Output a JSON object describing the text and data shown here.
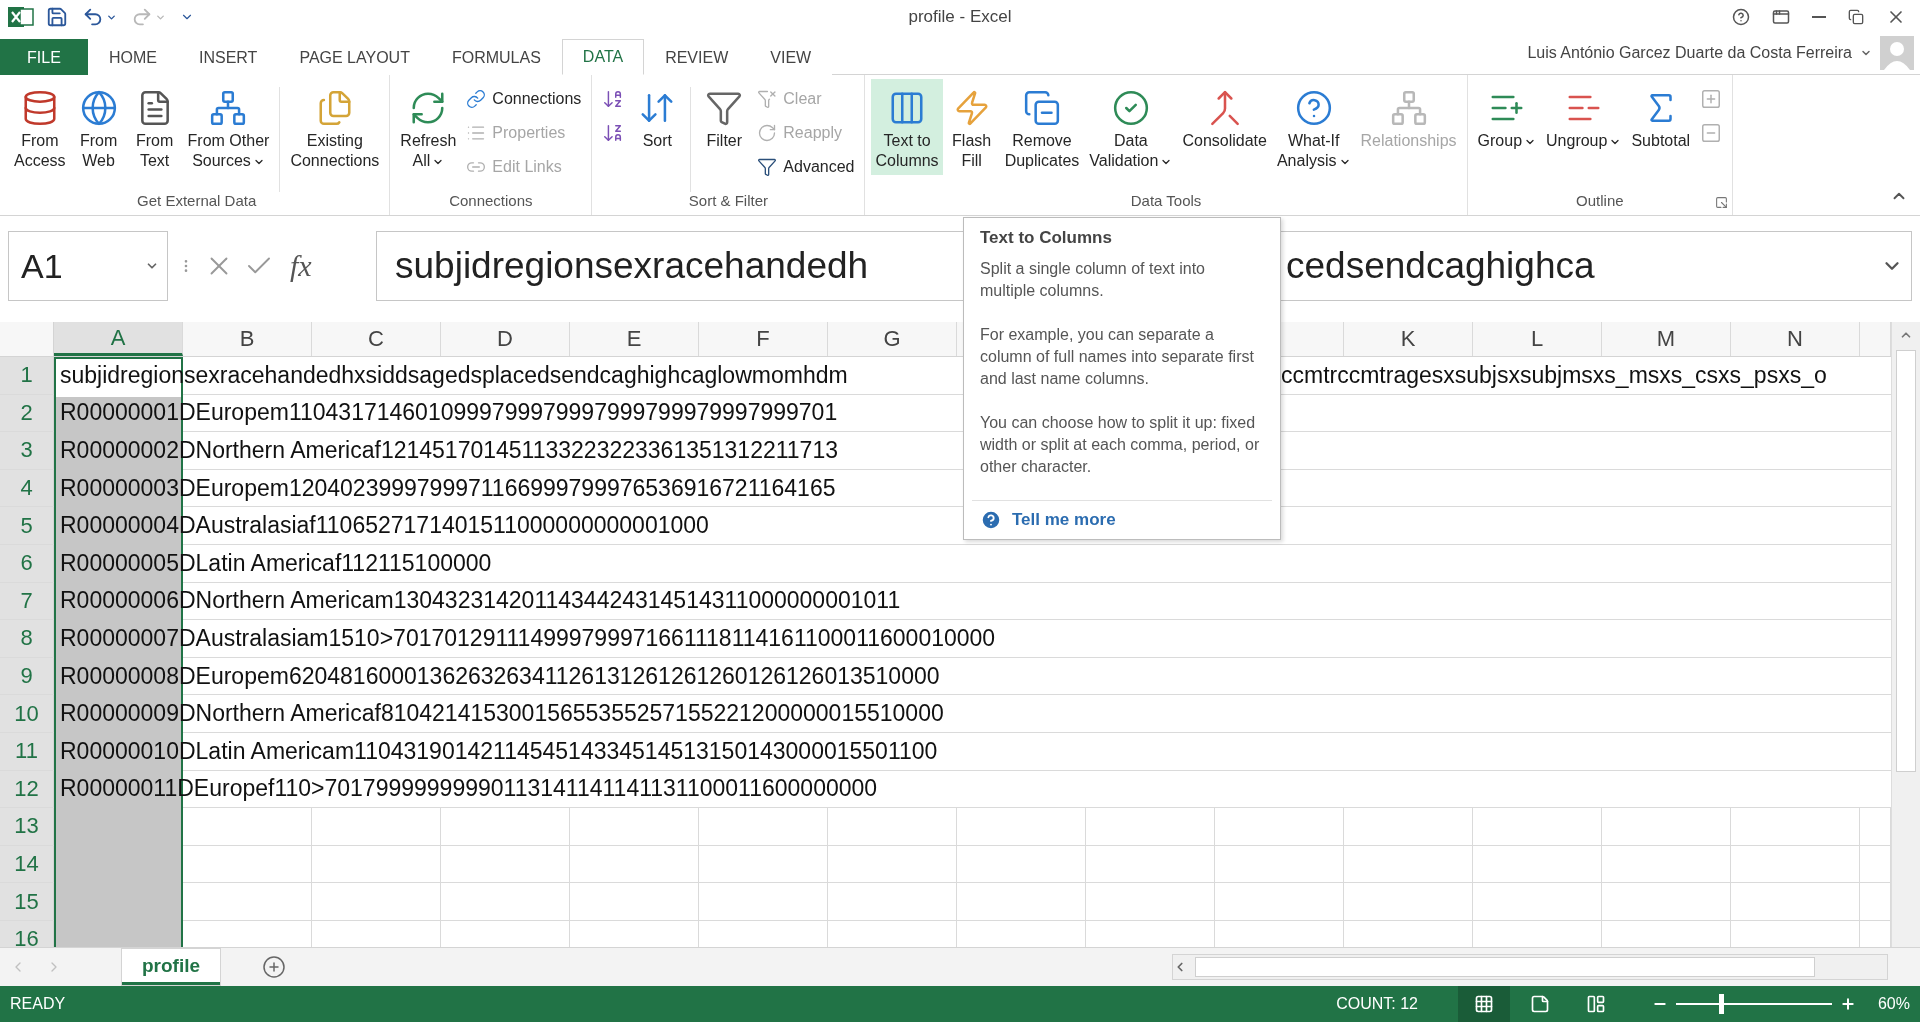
{
  "title_bar": {
    "title": "profile - Excel",
    "quick_access": [
      {
        "kind": "save",
        "disabled": false
      },
      {
        "kind": "undo",
        "disabled": false
      },
      {
        "kind": "redo",
        "disabled": true
      },
      {
        "kind": "customize",
        "disabled": false
      }
    ]
  },
  "ribbon_tabs": [
    {
      "label": "FILE",
      "kind": "file",
      "selected": false
    },
    {
      "label": "HOME",
      "kind": "tab",
      "selected": false
    },
    {
      "label": "INSERT",
      "kind": "tab",
      "selected": false
    },
    {
      "label": "PAGE LAYOUT",
      "kind": "tab",
      "selected": false
    },
    {
      "label": "FORMULAS",
      "kind": "tab",
      "selected": false
    },
    {
      "label": "DATA",
      "kind": "tab",
      "selected": true
    },
    {
      "label": "REVIEW",
      "kind": "tab",
      "selected": false
    },
    {
      "label": "VIEW",
      "kind": "tab",
      "selected": false
    }
  ],
  "account": {
    "user": "Luis António Garcez Duarte da Costa Ferreira"
  },
  "ribbon_groups": [
    {
      "label": "Get External Data",
      "launcher": false,
      "items": [
        {
          "kind": "large",
          "lines": [
            "From",
            "Access"
          ],
          "dropdown": false,
          "disabled": false,
          "highlighted": false
        },
        {
          "kind": "large",
          "lines": [
            "From",
            "Web"
          ],
          "dropdown": false,
          "disabled": false,
          "highlighted": false
        },
        {
          "kind": "large",
          "lines": [
            "From",
            "Text"
          ],
          "dropdown": false,
          "disabled": false,
          "highlighted": false
        },
        {
          "kind": "large",
          "lines": [
            "From Other",
            "Sources"
          ],
          "dropdown": true,
          "disabled": false,
          "highlighted": false
        },
        {
          "kind": "separator"
        },
        {
          "kind": "large",
          "lines": [
            "Existing",
            "Connections"
          ],
          "dropdown": false,
          "disabled": false,
          "highlighted": false
        }
      ]
    },
    {
      "label": "Connections",
      "launcher": false,
      "items": [
        {
          "kind": "large",
          "lines": [
            "Refresh",
            "All"
          ],
          "dropdown": true,
          "disabled": false,
          "highlighted": false
        },
        {
          "kind": "stack",
          "items": [
            {
              "kind": "small",
              "label": "Connections",
              "disabled": false
            },
            {
              "kind": "small",
              "label": "Properties",
              "disabled": true
            },
            {
              "kind": "small",
              "label": "Edit Links",
              "disabled": true
            }
          ]
        }
      ]
    },
    {
      "label": "Sort & Filter",
      "launcher": false,
      "items": [
        {
          "kind": "stack",
          "items": [
            {
              "kind": "icon",
              "disabled": false
            },
            {
              "kind": "icon",
              "disabled": false
            }
          ]
        },
        {
          "kind": "large",
          "lines": [
            "Sort"
          ],
          "dropdown": false,
          "disabled": false,
          "highlighted": false
        },
        {
          "kind": "separator"
        },
        {
          "kind": "large",
          "lines": [
            "Filter"
          ],
          "dropdown": false,
          "disabled": false,
          "highlighted": false
        },
        {
          "kind": "stack",
          "items": [
            {
              "kind": "small",
              "label": "Clear",
              "disabled": true
            },
            {
              "kind": "small",
              "label": "Reapply",
              "disabled": true
            },
            {
              "kind": "small",
              "label": "Advanced",
              "disabled": false
            }
          ]
        }
      ]
    },
    {
      "label": "Data Tools",
      "launcher": false,
      "items": [
        {
          "kind": "large",
          "lines": [
            "Text to",
            "Columns"
          ],
          "dropdown": false,
          "disabled": false,
          "highlighted": true
        },
        {
          "kind": "large",
          "lines": [
            "Flash",
            "Fill"
          ],
          "dropdown": false,
          "disabled": false,
          "highlighted": false
        },
        {
          "kind": "large",
          "lines": [
            "Remove",
            "Duplicates"
          ],
          "dropdown": false,
          "disabled": false,
          "highlighted": false
        },
        {
          "kind": "large",
          "lines": [
            "Data",
            "Validation"
          ],
          "dropdown": true,
          "disabled": false,
          "highlighted": false
        },
        {
          "kind": "large",
          "lines": [
            "Consolidate"
          ],
          "dropdown": false,
          "disabled": false,
          "highlighted": false
        },
        {
          "kind": "large",
          "lines": [
            "What-If",
            "Analysis"
          ],
          "dropdown": true,
          "disabled": false,
          "highlighted": false
        },
        {
          "kind": "large",
          "lines": [
            "Relationships"
          ],
          "dropdown": false,
          "disabled": true,
          "highlighted": false
        }
      ]
    },
    {
      "label": "Outline",
      "launcher": true,
      "items": [
        {
          "kind": "large",
          "lines": [
            "Group"
          ],
          "dropdown": true,
          "disabled": false,
          "highlighted": false
        },
        {
          "kind": "large",
          "lines": [
            "Ungroup"
          ],
          "dropdown": true,
          "disabled": false,
          "highlighted": false
        },
        {
          "kind": "large",
          "lines": [
            "Subtotal"
          ],
          "dropdown": false,
          "disabled": false,
          "highlighted": false
        },
        {
          "kind": "stack",
          "items": [
            {
              "kind": "icon",
              "disabled": true
            },
            {
              "kind": "icon",
              "disabled": true
            }
          ]
        }
      ]
    }
  ],
  "formula_bar": {
    "name_box": "A1",
    "function_button": "fx",
    "formula": "subjidregionsexracehandedh",
    "formula_after_tooltip": "cedsendcaghighca"
  },
  "columns": [
    {
      "label": "A",
      "selected": true
    },
    {
      "label": "B",
      "selected": false
    },
    {
      "label": "C",
      "selected": false
    },
    {
      "label": "D",
      "selected": false
    },
    {
      "label": "E",
      "selected": false
    },
    {
      "label": "F",
      "selected": false
    },
    {
      "label": "G",
      "selected": false
    }
  ],
  "columns_after_tooltip": [
    {
      "label": "K",
      "selected": false
    },
    {
      "label": "L",
      "selected": false
    },
    {
      "label": "M",
      "selected": false
    },
    {
      "label": "N",
      "selected": false
    }
  ],
  "rows": [
    {
      "number": "1",
      "selected": true,
      "active": true,
      "text": "subjidregionsexracehandedhxsiddsagedsplacedsendcaghighcaglowmomhdm",
      "text_after_tooltip": "ccmtrccmtragesxsubjsxsubjmsxs_msxs_csxs_psxs_o"
    },
    {
      "number": "2",
      "selected": true,
      "active": false,
      "text": "R00000001DEuropem1104317146010999799979997999799979997999701"
    },
    {
      "number": "3",
      "selected": true,
      "active": false,
      "text": "R00000002DNorthern Americaf121451701451133223223361351312211713"
    },
    {
      "number": "4",
      "selected": true,
      "active": false,
      "text": "R00000003DEuropem1204023999799971166999799976536916721164165"
    },
    {
      "number": "5",
      "selected": true,
      "active": false,
      "text": "R00000004DAustralasiaf1106527171401511000000000001000"
    },
    {
      "number": "6",
      "selected": true,
      "active": false,
      "text": "R00000005DLatin Americaf112115100000"
    },
    {
      "number": "7",
      "selected": true,
      "active": false,
      "text": "R00000006DNorthern Americam1304323142011434424314514311000000001011"
    },
    {
      "number": "8",
      "selected": true,
      "active": false,
      "text": "R00000007DAustralasiam1510>701701291114999799971661118114161100011600010000"
    },
    {
      "number": "9",
      "selected": true,
      "active": false,
      "text": "R00000008DEuropem620481600013626326341126131261261260126126013510000"
    },
    {
      "number": "10",
      "selected": true,
      "active": false,
      "text": "R00000009DNorthern Americaf81042141530015655355257155221200000015510000"
    },
    {
      "number": "11",
      "selected": true,
      "active": false,
      "text": "R00000010DLatin Americam1104319014211454514334514513150143000015501100"
    },
    {
      "number": "12",
      "selected": true,
      "active": false,
      "text": "R00000011DEuropef110>70179999999990113141141141131100011600000000"
    },
    {
      "number": "13",
      "selected": true,
      "active": false
    },
    {
      "number": "14",
      "selected": true,
      "active": false
    },
    {
      "number": "15",
      "selected": true,
      "active": false
    },
    {
      "number": "16",
      "selected": true,
      "active": false
    }
  ],
  "tooltip": {
    "title": "Text to Columns",
    "paragraphs": [
      "Split a single column of text into multiple columns.",
      "For example, you can separate a column of full names into separate first and last name columns.",
      "You can choose how to split it up: fixed width or split at each comma, period, or other character."
    ],
    "link": "Tell me more"
  },
  "sheet_tabs": [
    {
      "label": "profile",
      "selected": true
    }
  ],
  "status_bar": {
    "mode": "READY",
    "count": "COUNT: 12",
    "views": [
      {
        "kind": "normal",
        "selected": true
      },
      {
        "kind": "page_layout",
        "selected": false
      },
      {
        "kind": "page_break",
        "selected": false
      }
    ],
    "zoom": {
      "level": 0.29,
      "reading": "60%"
    }
  }
}
